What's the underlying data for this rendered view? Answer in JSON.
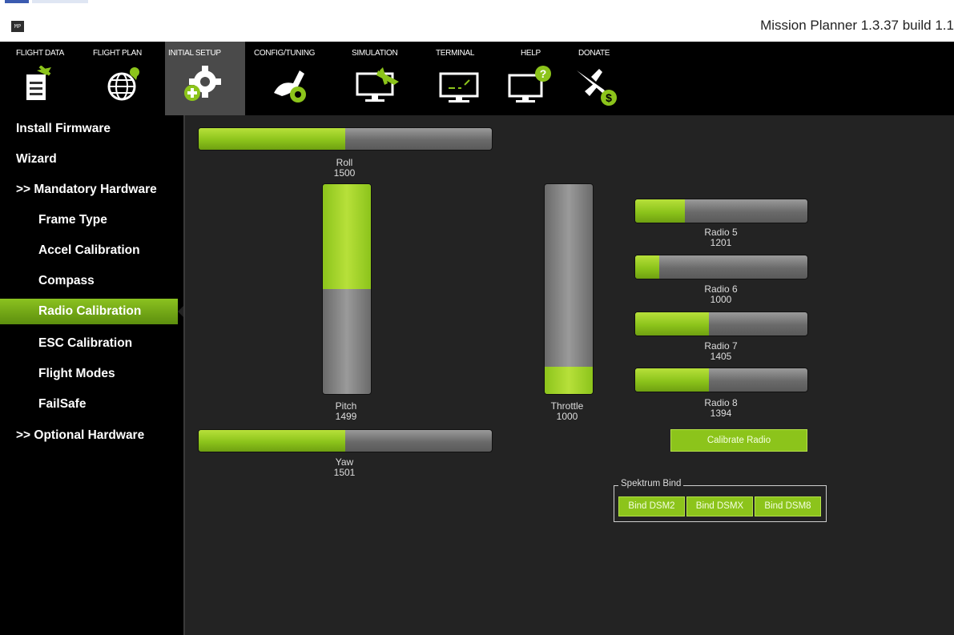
{
  "window": {
    "app_icon_text": "MP",
    "title": "Mission Planner 1.3.37 build 1.1"
  },
  "toolbar": {
    "items": [
      {
        "label": "FLIGHT DATA",
        "icon": "flight-data-icon"
      },
      {
        "label": "FLIGHT PLAN",
        "icon": "flight-plan-icon"
      },
      {
        "label": "INITIAL SETUP",
        "icon": "initial-setup-icon"
      },
      {
        "label": "CONFIG/TUNING",
        "icon": "config-tuning-icon"
      },
      {
        "label": "SIMULATION",
        "icon": "simulation-icon"
      },
      {
        "label": "TERMINAL",
        "icon": "terminal-icon"
      },
      {
        "label": "HELP",
        "icon": "help-icon"
      },
      {
        "label": "DONATE",
        "icon": "donate-icon"
      }
    ],
    "active": "INITIAL SETUP"
  },
  "sidebar": {
    "items": [
      {
        "label": "Install Firmware"
      },
      {
        "label": "Wizard"
      },
      {
        "label": ">> Mandatory Hardware"
      },
      {
        "label": "Frame Type"
      },
      {
        "label": "Accel Calibration"
      },
      {
        "label": "Compass"
      },
      {
        "label": "Radio Calibration"
      },
      {
        "label": "ESC Calibration"
      },
      {
        "label": "Flight Modes"
      },
      {
        "label": "FailSafe"
      },
      {
        "label": ">> Optional Hardware"
      }
    ],
    "active": "Radio Calibration"
  },
  "channels": {
    "roll": {
      "name": "Roll",
      "value": "1500",
      "level": 0.5
    },
    "pitch": {
      "name": "Pitch",
      "value": "1499",
      "level": 0.5
    },
    "yaw": {
      "name": "Yaw",
      "value": "1501",
      "level": 0.5
    },
    "throttle": {
      "name": "Throttle",
      "value": "1000",
      "level": 0.0
    },
    "radio5": {
      "name": "Radio 5",
      "value": "1201",
      "level": 0.29
    },
    "radio6": {
      "name": "Radio 6",
      "value": "1000",
      "level": 0.0
    },
    "radio7": {
      "name": "Radio 7",
      "value": "1405",
      "level": 0.43
    },
    "radio8": {
      "name": "Radio 8",
      "value": "1394",
      "level": 0.43
    }
  },
  "buttons": {
    "calibrate": "Calibrate Radio",
    "spektrum_title": "Spektrum Bind",
    "bind_dsm2": "Bind DSM2",
    "bind_dsmx": "Bind DSMX",
    "bind_dsm8": "Bind DSM8"
  },
  "colors": {
    "accent": "#8cc41b",
    "panel_bg": "#232323",
    "toolbar_bg": "#000000"
  }
}
